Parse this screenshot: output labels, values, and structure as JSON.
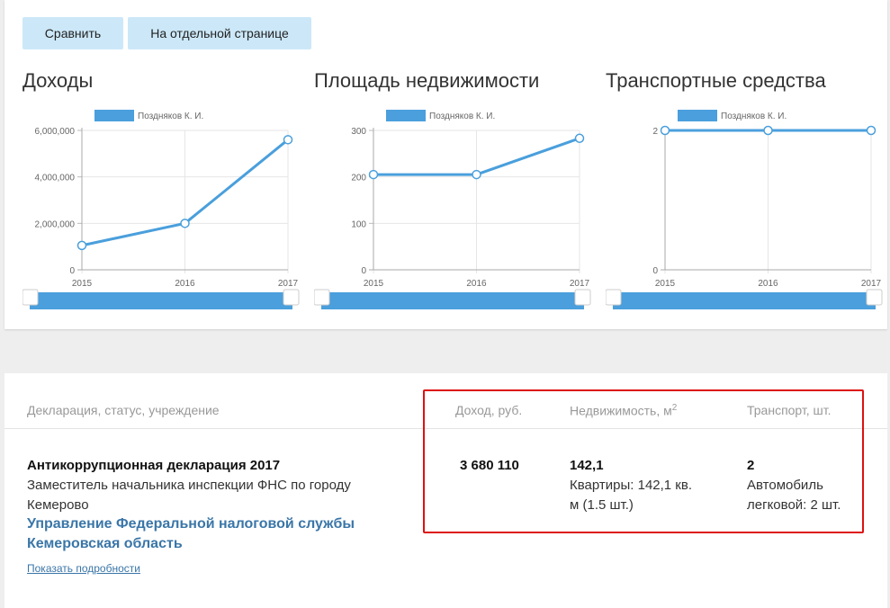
{
  "buttons": {
    "compare": "Сравнить",
    "separate_page": "На отдельной странице"
  },
  "charts": [
    {
      "title": "Доходы",
      "legend": "Поздняков К. И.",
      "y_tick_labels": [
        "0",
        "2,000,000",
        "4,000,000",
        "6,000,000"
      ],
      "x_tick_labels": [
        "2015",
        "2016",
        "2017"
      ]
    },
    {
      "title": "Площадь недвижимости",
      "legend": "Поздняков К. И.",
      "y_tick_labels": [
        "0",
        "100",
        "200",
        "300"
      ],
      "x_tick_labels": [
        "2015",
        "2016",
        "2017"
      ]
    },
    {
      "title": "Транспортные средства",
      "legend": "Поздняков К. И.",
      "y_tick_labels": [
        "0",
        "2"
      ],
      "x_tick_labels": [
        "2015",
        "2016",
        "2017"
      ]
    }
  ],
  "chart_data": [
    {
      "type": "line",
      "title": "Доходы",
      "x": [
        2015,
        2016,
        2017
      ],
      "series": [
        {
          "name": "Поздняков К. И.",
          "values": [
            1050000,
            2000000,
            5600000
          ]
        }
      ],
      "ylim": [
        0,
        6000000
      ],
      "yticks": [
        0,
        2000000,
        4000000,
        6000000
      ],
      "color": "#4a9fdc",
      "grid": true,
      "legend": "top-center"
    },
    {
      "type": "line",
      "title": "Площадь недвижимости",
      "x": [
        2015,
        2016,
        2017
      ],
      "series": [
        {
          "name": "Поздняков К. И.",
          "values": [
            205,
            205,
            283
          ]
        }
      ],
      "ylim": [
        0,
        300
      ],
      "yticks": [
        0,
        100,
        200,
        300
      ],
      "color": "#4a9fdc",
      "grid": true,
      "legend": "top-center"
    },
    {
      "type": "line",
      "title": "Транспортные средства",
      "x": [
        2015,
        2016,
        2017
      ],
      "series": [
        {
          "name": "Поздняков К. И.",
          "values": [
            2,
            2,
            2
          ]
        }
      ],
      "ylim": [
        0,
        2
      ],
      "yticks": [
        0,
        2
      ],
      "color": "#4a9fdc",
      "grid": true,
      "legend": "top-center"
    }
  ],
  "table": {
    "headers": {
      "declaration": "Декларация, статус, учреждение",
      "income": "Доход, руб.",
      "realty": "Недвижимость, м",
      "realty_sup": "2",
      "transport": "Транспорт, шт."
    },
    "row": {
      "title": "Антикоррупционная декларация 2017",
      "position": "Заместитель начальника инспекции ФНС по городу Кемерово",
      "organization": "Управление Федеральной налоговой службы Кемеровская область",
      "income": "3 680 110",
      "realty_total": "142,1",
      "realty_detail": "Квартиры: 142,1 кв. м (1.5 шт.)",
      "transport_total": "2",
      "transport_detail": "Автомобиль легковой: 2 шт.",
      "details_link": "Показать подробности"
    }
  },
  "colors": {
    "accent": "#4a9fdc",
    "highlight": "#dd1111",
    "link": "#3a76a8",
    "button_bg": "#cce8f8"
  }
}
